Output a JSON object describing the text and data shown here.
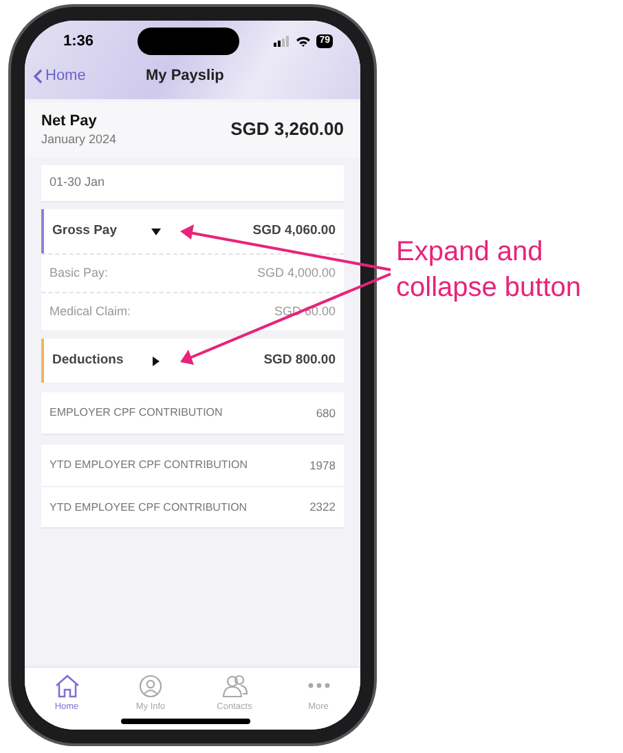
{
  "status_bar": {
    "time": "1:36",
    "battery": "79"
  },
  "nav": {
    "back": "Home",
    "title": "My Payslip"
  },
  "net_pay": {
    "label": "Net Pay",
    "period": "January 2024",
    "amount": "SGD 3,260.00"
  },
  "date_range": "01-30 Jan",
  "sections": [
    {
      "label": "Gross Pay",
      "amount": "SGD 4,060.00",
      "color": "#8a84d6",
      "expanded": true,
      "rows": [
        {
          "label": "Basic Pay:",
          "value": "SGD 4,000.00"
        },
        {
          "label": "Medical Claim:",
          "value": "SGD 60.00"
        }
      ]
    },
    {
      "label": "Deductions",
      "amount": "SGD 800.00",
      "color": "#f2b45a",
      "expanded": false
    }
  ],
  "cpf_cards": [
    [
      {
        "label": "EMPLOYER CPF CONTRIBUTION",
        "value": "680"
      }
    ],
    [
      {
        "label": "YTD EMPLOYER CPF CONTRIBUTION",
        "value": "1978"
      },
      {
        "label": "YTD EMPLOYEE CPF CONTRIBUTION",
        "value": "2322"
      }
    ]
  ],
  "tab_bar": [
    {
      "label": "Home",
      "selected": true
    },
    {
      "label": "My Info",
      "selected": false
    },
    {
      "label": "Contacts",
      "selected": false
    },
    {
      "label": "More",
      "selected": false
    }
  ],
  "annotation": "Expand and collapse button"
}
